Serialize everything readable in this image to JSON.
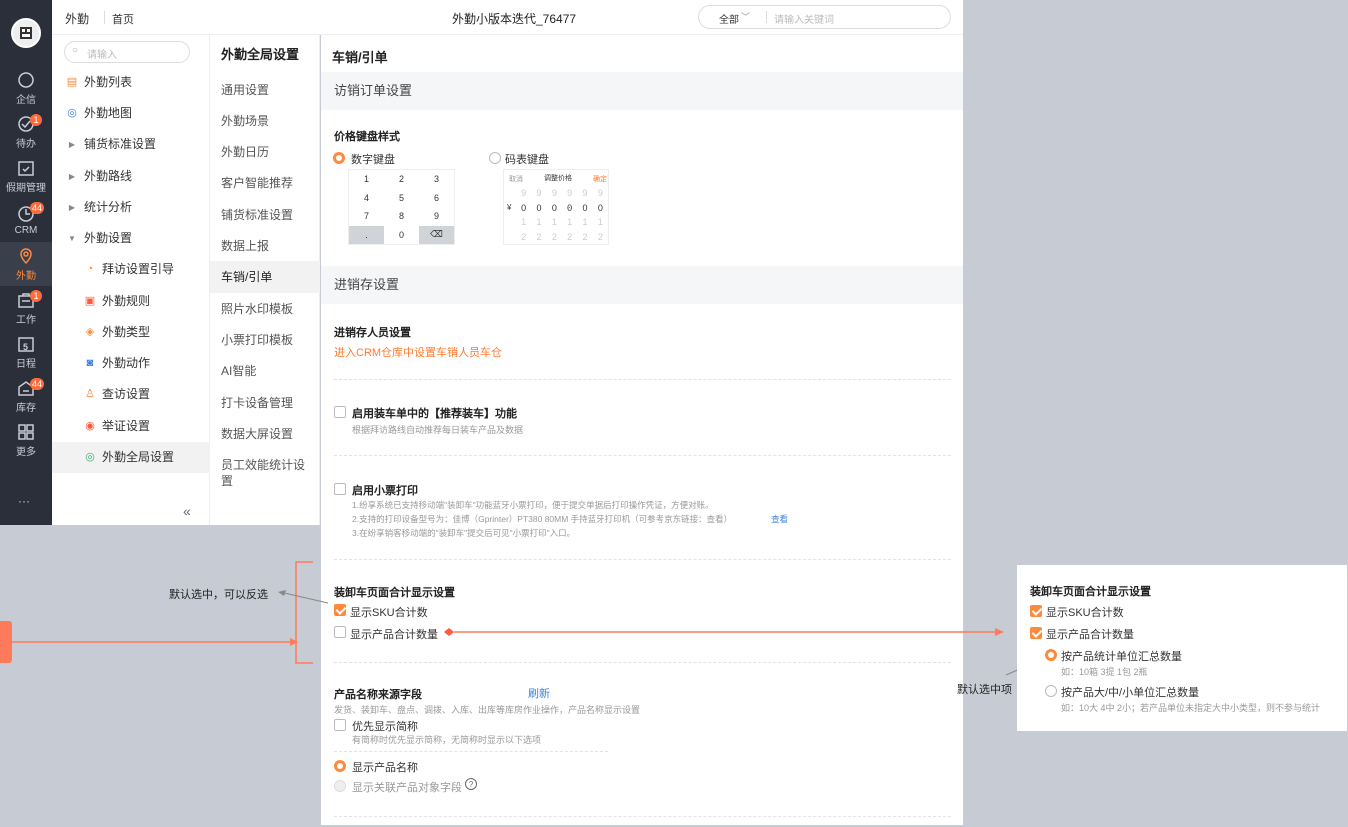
{
  "rail": {
    "items": [
      {
        "label": "企信",
        "icon": "chat-icon",
        "badge": ""
      },
      {
        "label": "待办",
        "icon": "check-icon",
        "badge": "1"
      },
      {
        "label": "假期管理",
        "icon": "calendar-check-icon",
        "badge": ""
      },
      {
        "label": "CRM",
        "icon": "crm-icon",
        "badge": "44"
      },
      {
        "label": "外勤",
        "icon": "location-icon",
        "badge": ""
      },
      {
        "label": "工作",
        "icon": "briefcase-icon",
        "badge": "1"
      },
      {
        "label": "日程",
        "icon": "calendar-icon",
        "badge": ""
      },
      {
        "label": "库存",
        "icon": "warehouse-icon",
        "badge": "44"
      },
      {
        "label": "更多",
        "icon": "grid-icon",
        "badge": ""
      }
    ],
    "more": "···",
    "calendar_day": "5"
  },
  "topbar": {
    "app": "外勤",
    "home": "首页",
    "title": "外勤小版本迭代_76477",
    "search_scope": "全部",
    "search_placeholder": "请输入关键词"
  },
  "nav1": {
    "search_placeholder": "请输入",
    "items": [
      {
        "label": "外勤列表",
        "icon": "list-icon"
      },
      {
        "label": "外勤地图",
        "icon": "map-icon"
      },
      {
        "label": "铺货标准设置",
        "icon": "caret-right-icon"
      },
      {
        "label": "外勤路线",
        "icon": "caret-right-icon"
      },
      {
        "label": "统计分析",
        "icon": "caret-right-icon"
      },
      {
        "label": "外勤设置",
        "icon": "caret-down-icon"
      },
      {
        "label": "拜访设置引导",
        "icon": "guide-icon"
      },
      {
        "label": "外勤规则",
        "icon": "rule-icon"
      },
      {
        "label": "外勤类型",
        "icon": "layers-icon"
      },
      {
        "label": "外勤动作",
        "icon": "camera-icon"
      },
      {
        "label": "查访设置",
        "icon": "user-icon"
      },
      {
        "label": "举证设置",
        "icon": "evidence-icon"
      },
      {
        "label": "外勤全局设置",
        "icon": "settings-icon"
      }
    ],
    "collapse": "«"
  },
  "nav2": {
    "title": "外勤全局设置",
    "items": [
      "通用设置",
      "外勤场景",
      "外勤日历",
      "客户智能推荐",
      "铺货标准设置",
      "数据上报",
      "车销/引单",
      "照片水印模板",
      "小票打印模板",
      "AI智能",
      "打卡设备管理",
      "数据大屏设置",
      "员工效能统计设置"
    ]
  },
  "main": {
    "title": "车销/引单",
    "visit_section": "访销订单设置",
    "keyboard_title": "价格键盘样式",
    "numeric_label": "数字键盘",
    "code_label": "码表键盘",
    "numeric_keys": [
      "1",
      "2",
      "3",
      "4",
      "5",
      "6",
      "7",
      "8",
      "9",
      ".",
      "0",
      "⌫"
    ],
    "code_header": [
      "取消",
      "调整价格",
      "确定"
    ],
    "code_rows": [
      [
        "9",
        "9",
        "9",
        "9",
        "9",
        "9"
      ],
      [
        "0",
        "0",
        "0",
        "0",
        "0",
        "0"
      ],
      [
        "1",
        "1",
        "1",
        "1",
        "1",
        "1"
      ],
      [
        "2",
        "2",
        "2",
        "2",
        "2",
        "2"
      ]
    ],
    "code_currency": "¥",
    "code_dot": "·",
    "inv_section": "进销存设置",
    "inv_staff_title": "进销存人员设置",
    "inv_staff_link": "进入CRM仓库中设置车销人员车仓",
    "rec_label": "启用装车单中的【推荐装车】功能",
    "rec_desc": "根据拜访路线自动推荐每日装车产品及数据",
    "print_label": "启用小票打印",
    "print_desc1": "1.纷享系统已支持移动端\"装卸车\"功能蓝牙小票打印，便于提交单据后打印操作凭证，方便对账。",
    "print_desc2": "2.支持的打印设备型号为：佳博（Gprinter）PT380 80MM 手持蓝牙打印机（可参考京东链接：查看）",
    "print_desc2_link": "查看",
    "print_desc3": "3.在纷享销客移动端的\"装卸车\"提交后可见\"小票打印\"入口。",
    "total_title": "装卸车页面合计显示设置",
    "sku_label": "显示SKU合计数",
    "qty_label": "显示产品合计数量",
    "name_title": "产品名称来源字段",
    "refresh": "刷新",
    "name_desc": "发货、装卸车、盘点、调拨、入库、出库等库房作业操作，产品名称显示设置",
    "short_label": "优先显示简称",
    "short_desc": "有简称时优先显示简称，无简称时显示以下选项",
    "show_name": "显示产品名称",
    "show_related": "显示关联产品对象字段",
    "help": "?"
  },
  "annotations": {
    "default_reverse": "默认选中，可以反选",
    "default_item": "默认选中项"
  },
  "callout": {
    "title": "装卸车页面合计显示设置",
    "sku": "显示SKU合计数",
    "qty": "显示产品合计数量",
    "opt1": "按产品统计单位汇总数量",
    "opt1_desc": "如：10箱 3提 1包 2瓶",
    "opt2": "按产品大/中/小单位汇总数量",
    "opt2_desc": "如：10大 4中 2小；若产品单位未指定大中小类型，则不参与统计"
  },
  "colors": {
    "accent": "#ff8a3d",
    "rail": "#2b2f3a",
    "link": "#3d7fe0",
    "background": "#c7cbd3"
  }
}
